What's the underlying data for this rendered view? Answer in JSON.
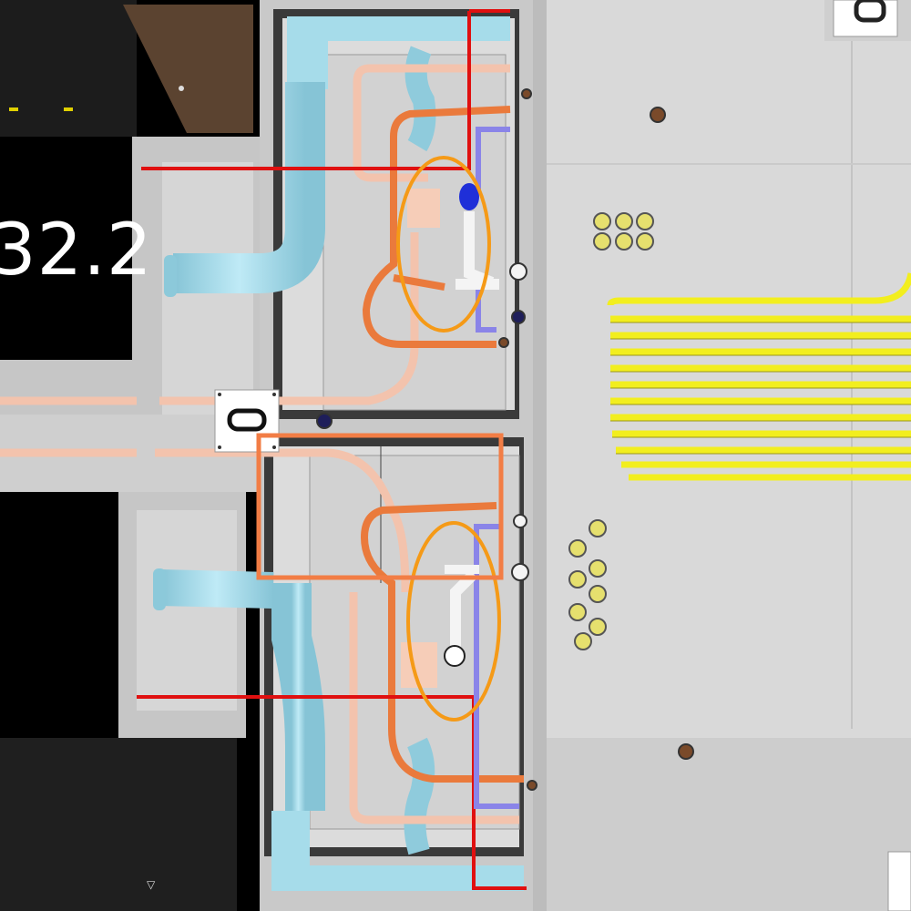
{
  "scene": {
    "room_label": "32.2",
    "colors": {
      "background": "#000000",
      "floor": "#d8d8d8",
      "wall": "#c6c6c6",
      "duct_blue": "#a6dcea",
      "pipe_salmon": "#f3c3ad",
      "pipe_orange": "#ea7a3c",
      "pipe_red": "#e01010",
      "pipe_purple": "#8a84e8",
      "cable_yellow": "#f2ee1e",
      "highlight_ellipse": "#f59a17",
      "highlight_box": "#f27d45",
      "door_brown": "#5b4330"
    }
  }
}
